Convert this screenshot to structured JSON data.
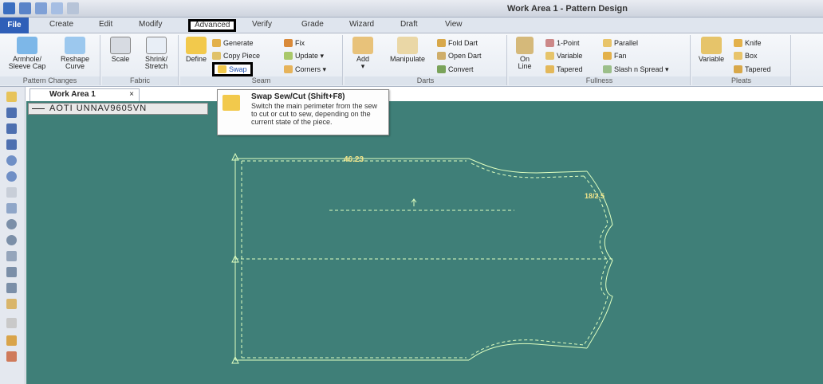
{
  "window": {
    "title": "Work Area 1 - Pattern Design"
  },
  "tabs": [
    "File",
    "Create",
    "Edit",
    "Modify",
    "Advanced",
    "Verify",
    "Grade",
    "Wizard",
    "Draft",
    "View"
  ],
  "ribbon": {
    "pattern_changes": {
      "label": "Pattern Changes",
      "armhole": "Armhole/\nSleeve Cap",
      "reshape": "Reshape\nCurve"
    },
    "fabric": {
      "label": "Fabric",
      "scale": "Scale",
      "shrink": "Shrink/\nStretch"
    },
    "seam": {
      "label": "Seam",
      "define": "Define",
      "generate": "Generate",
      "copy_piece": "Copy Piece",
      "swap": "Swap",
      "fix": "Fix",
      "update": "Update ▾",
      "corners": "Corners ▾"
    },
    "darts": {
      "label": "Darts",
      "add": "Add\n▾",
      "manipulate": "Manipulate",
      "fold_dart": "Fold Dart",
      "open_dart": "Open Dart",
      "convert": "Convert",
      "on_line": "On\nLine"
    },
    "fullness": {
      "label": "Fullness",
      "one_point": "1-Point",
      "parallel": "Parallel",
      "variable": "Variable",
      "fan": "Fan",
      "tapered": "Tapered",
      "slash_spread": "Slash n Spread ▾"
    },
    "pleats": {
      "label": "Pleats",
      "variable": "Variable",
      "knife": "Knife",
      "box": "Box",
      "tapered": "Tapered"
    }
  },
  "tooltip": {
    "title": "Swap Sew/Cut (Shift+F8)",
    "body": "Switch the main perimeter from the sew to cut or cut to sew, depending on the current state of the piece."
  },
  "document": {
    "tab_label": "Work Area 1",
    "close": "×",
    "piece_name": "AOTI UNNAV9605VN"
  },
  "pattern": {
    "width_label": "46.23",
    "side_label": "18/2.5"
  },
  "colors": {
    "canvas": "#3f7f78",
    "pattern_line": "#dfffc0",
    "measure": "#f3e58a",
    "file_tab": "#2f5fb8"
  }
}
